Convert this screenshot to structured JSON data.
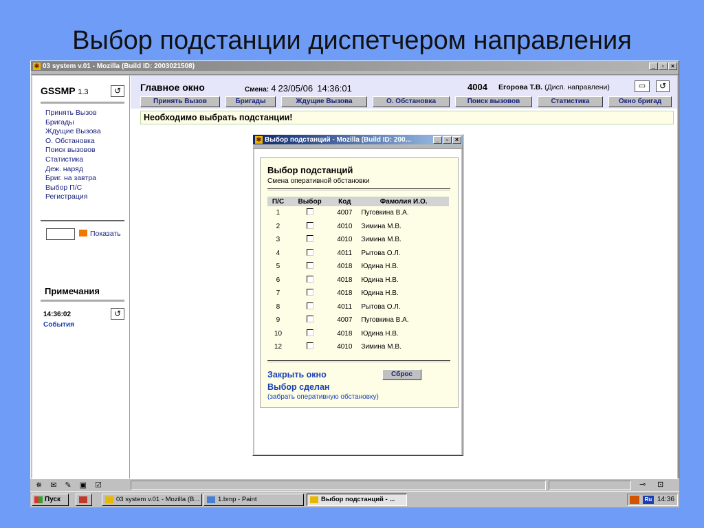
{
  "slide_title": "Выбор подстанции диспетчером направления",
  "main_window": {
    "title": "03 system v.01 - Mozilla (Build ID: 2003021508)",
    "controls": {
      "minimize": "_",
      "maximize": "▫",
      "close": "×"
    }
  },
  "sidebar": {
    "brand": "GSSMP",
    "version": "1.3",
    "refresh_glyph": "↺",
    "nav": [
      "Принять Вызов",
      "Бригады",
      "Ждущие Вызова",
      "О. Обстановка",
      "Поиск вызовов",
      "Статистика",
      "Деж. наряд",
      "Бриг. на завтра",
      "Выбор П/С",
      "Регистрация"
    ],
    "show_label": "Показать",
    "notes_title": "Примечания",
    "time": "14:36:02",
    "events": "События"
  },
  "header": {
    "title": "Главное окно",
    "shift_label": "Смена:",
    "shift_value": "4",
    "date": "23/05/06",
    "time": "14:36:01",
    "code": "4004",
    "user_name": "Егорова Т.В.",
    "user_role": "(Дисп. направлени)"
  },
  "buttons": [
    "Принять Вызов",
    "Бригады",
    "Ждущие Вызова",
    "О. Обстановка",
    "Поиск вызовов",
    "Статистика",
    "Окно бригад"
  ],
  "notice": "Необходимо выбрать подстанции!",
  "dialog": {
    "title": "Выбор подстанций - Mozilla (Build ID: 200...",
    "heading": "Выбор подстанций",
    "subheading": "Смена оперативной обстановки",
    "columns": [
      "П/С",
      "Выбор",
      "Код",
      "Фамолия И.О."
    ],
    "rows": [
      {
        "ps": "1",
        "code": "4007",
        "name": "Пуговкина В.А."
      },
      {
        "ps": "2",
        "code": "4010",
        "name": "Зимина М.В."
      },
      {
        "ps": "3",
        "code": "4010",
        "name": "Зимина М.В."
      },
      {
        "ps": "4",
        "code": "4011",
        "name": "Рытова О.Л."
      },
      {
        "ps": "5",
        "code": "4018",
        "name": "Юдина Н.В."
      },
      {
        "ps": "6",
        "code": "4018",
        "name": "Юдина Н.В."
      },
      {
        "ps": "7",
        "code": "4018",
        "name": "Юдина Н.В."
      },
      {
        "ps": "8",
        "code": "4011",
        "name": "Рытова О.Л."
      },
      {
        "ps": "9",
        "code": "4007",
        "name": "Пуговкина В.А."
      },
      {
        "ps": "10",
        "code": "4018",
        "name": "Юдина Н.В."
      },
      {
        "ps": "12",
        "code": "4010",
        "name": "Зимина М.В."
      }
    ],
    "close_link": "Закрыть окно",
    "reset_button": "Сброс",
    "done_link": "Выбор сделан",
    "take_link": "(забрать оперативную обстановку)"
  },
  "taskbar": {
    "start": "Пуск",
    "tasks": [
      "03 system v.01 - Mozilla (B...",
      "1.bmp - Paint",
      "Выбор подстанций - ..."
    ],
    "lang": "Ru",
    "clock": "14:36"
  }
}
